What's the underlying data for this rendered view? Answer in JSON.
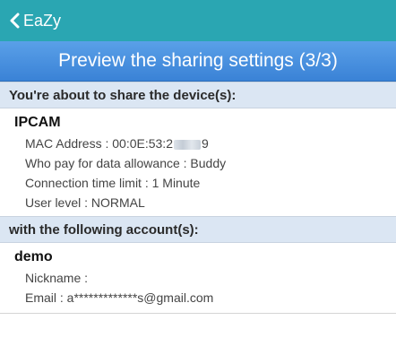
{
  "topbar": {
    "back_label": "EaZy"
  },
  "banner": {
    "title": "Preview the sharing settings (3/3)"
  },
  "device_section": {
    "header": "You're about to share the device(s):",
    "name": "IPCAM",
    "mac_prefix": "MAC Address : 00:0E:53:2",
    "mac_suffix": "9",
    "data_allowance": "Who pay for data allowance : Buddy",
    "time_limit": "Connection time limit : 1 Minute",
    "user_level": "User level : NORMAL"
  },
  "account_section": {
    "header": "with the following account(s):",
    "name": "demo",
    "nickname": "Nickname :",
    "email": "Email : a*************s@gmail.com"
  },
  "colors": {
    "topbar": "#2aa6b2",
    "banner": "#4a90e2",
    "section_header": "#dbe6f3"
  }
}
